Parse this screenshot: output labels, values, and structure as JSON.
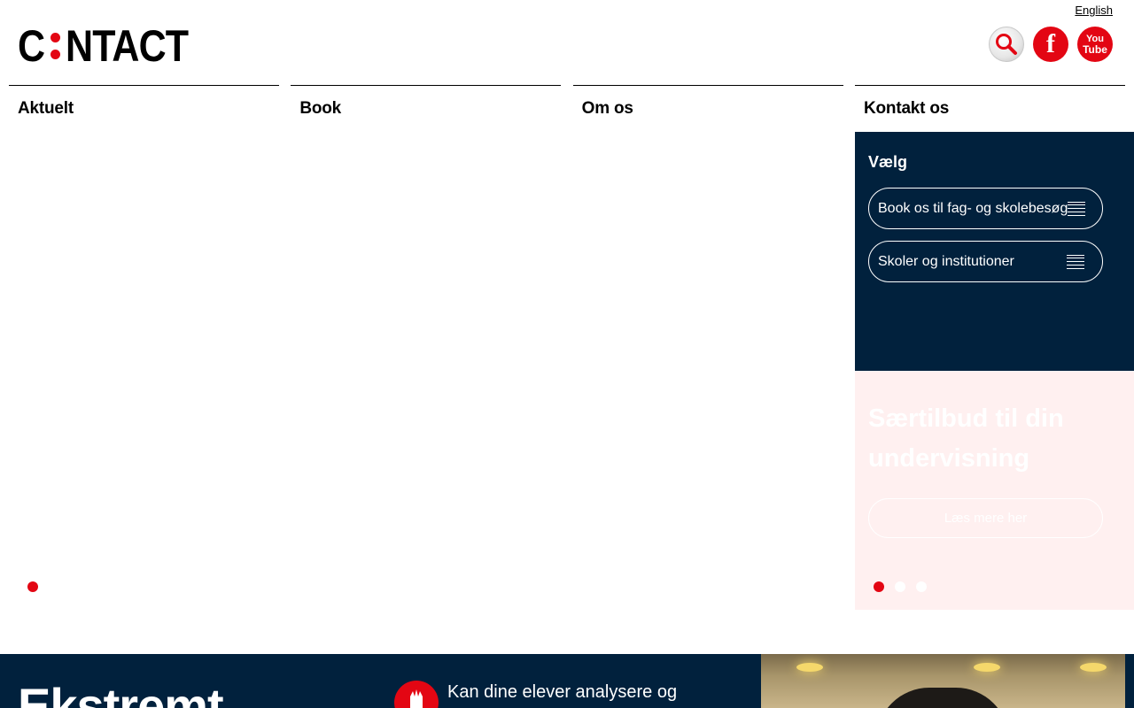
{
  "header": {
    "language_link": "English",
    "logo": {
      "letter_c": "C",
      "rest": "NTACT"
    },
    "icons": {
      "search": "search-icon",
      "facebook": "facebook-icon",
      "facebook_glyph": "f",
      "youtube": "youtube-icon",
      "youtube_top": "You",
      "youtube_bottom": "Tube"
    }
  },
  "nav": {
    "items": [
      {
        "label": "Aktuelt"
      },
      {
        "label": "Book"
      },
      {
        "label": "Om os"
      },
      {
        "label": "Kontakt os"
      }
    ]
  },
  "slider": {
    "active_index": 0
  },
  "contact_panel": {
    "title": "Vælg",
    "selects": [
      {
        "label": "Book os til fag- og skolebesøg"
      },
      {
        "label": "Skoler og institutioner"
      }
    ]
  },
  "offer_panel": {
    "title": "Særtilbud til din undervisning",
    "button_label": "Læs mere her",
    "slide_count": 3,
    "active_slide": 0
  },
  "bottom": {
    "heading": "Ekstremt",
    "text": "Kan dine elever analysere og"
  },
  "colors": {
    "accent": "#e30613",
    "navy": "#01213d",
    "offer_bg": "#fff0f0"
  }
}
